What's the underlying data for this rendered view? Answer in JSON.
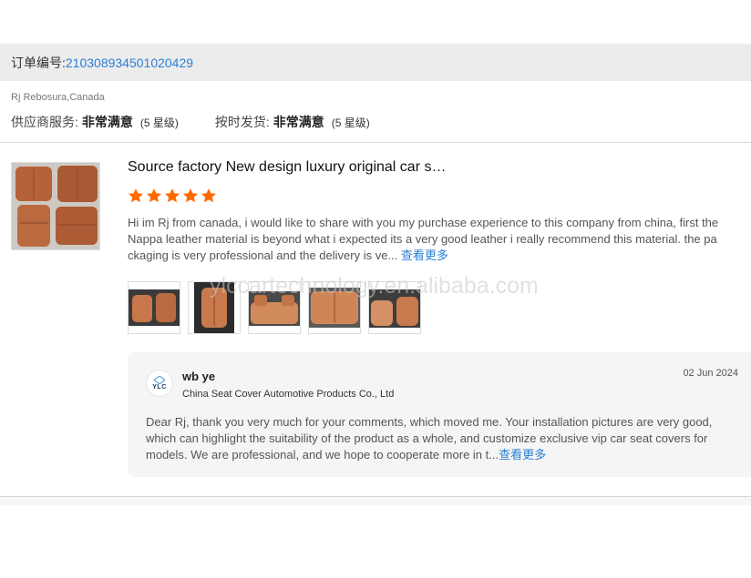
{
  "order": {
    "label": "订单编号:",
    "number": "210308934501020429"
  },
  "buyer": {
    "name_location": "Rj Rebosura,Canada"
  },
  "ratings": [
    {
      "label": "供应商服务:",
      "value": "非常满意",
      "level": "(5 星级)"
    },
    {
      "label": "按时发货:",
      "value": "非常满意",
      "level": "(5 星级)"
    }
  ],
  "review": {
    "product_title": "Source factory New design luxury original car s…",
    "stars": 5,
    "star_color": "#ff6a00",
    "text": "Hi im Rj from canada, i would like to share with you my purchase experience to this company from china, first the Nappa leather material is beyond what i expected its a very good leather i really recommend this material.   the packaging is very professional and the delivery is ve...",
    "more_label": "查看更多",
    "photo_count": 5
  },
  "watermark": "ylccartechnology.en.alibaba.com",
  "reply": {
    "logo_text": "YLC",
    "name": "wb ye",
    "company": "China Seat Cover Automotive Products Co., Ltd",
    "date": "02 Jun 2024",
    "text": "Dear Rj, thank you very much for your comments, which moved me. Your installation pictures are very good, which can highlight the suitability of the product as a whole, and customize exclusive vip car seat covers for models. We are professional, and we hope to cooperate more in t...",
    "more_label": "查看更多"
  },
  "colors": {
    "link": "#2a7fd4",
    "order_bar_bg": "#ececec",
    "reply_bg": "#f5f5f5",
    "leather": "#b5623a"
  }
}
